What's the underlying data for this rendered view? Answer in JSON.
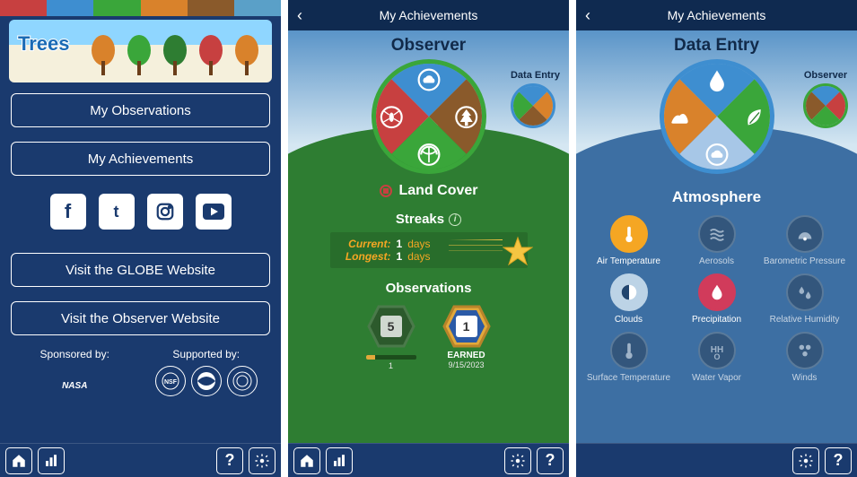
{
  "screen1": {
    "trees_label": "Trees",
    "buttons": {
      "my_observations": "My Observations",
      "my_achievements": "My Achievements",
      "visit_globe": "Visit the GLOBE Website",
      "visit_observer": "Visit the Observer Website"
    },
    "social": [
      "facebook",
      "twitter",
      "instagram",
      "youtube"
    ],
    "sponsored_by": "Sponsored by:",
    "supported_by": "Supported by:",
    "sponsor_logos": [
      "NASA"
    ],
    "supporter_logos": [
      "NSF",
      "NOAA",
      "DOS"
    ]
  },
  "screen2": {
    "header": "My Achievements",
    "title": "Observer",
    "mini_label": "Data Entry",
    "wheel_border": "#3aa63a",
    "wheel_quads": [
      {
        "bg": "#3e8ed0",
        "icon": "cloud"
      },
      {
        "bg": "#8a5a2b",
        "icon": "tree"
      },
      {
        "bg": "#c74040",
        "icon": "mosquito"
      },
      {
        "bg": "#3aa63a",
        "icon": "landcover"
      }
    ],
    "mini_border": "#3e8ed0",
    "mini_quads": [
      "#3e8ed0",
      "#d9822b",
      "#3aa63a",
      "#8a5a2b"
    ],
    "selected_label": "Land Cover",
    "streaks_label": "Streaks",
    "streak_current_label": "Current:",
    "streak_current_val": "1",
    "streak_longest_label": "Longest:",
    "streak_longest_val": "1",
    "streak_unit": "days",
    "observations_label": "Observations",
    "badge_locked": {
      "num": "5",
      "progress": 0.18,
      "count": "1"
    },
    "badge_earned": {
      "num": "1",
      "label": "EARNED",
      "date": "9/15/2023"
    }
  },
  "screen3": {
    "header": "My Achievements",
    "title": "Data Entry",
    "mini_label": "Observer",
    "wheel_border": "#3e8ed0",
    "wheel_quads": [
      {
        "bg": "#3e8ed0",
        "icon": "drop"
      },
      {
        "bg": "#3aa63a",
        "icon": "leaf"
      },
      {
        "bg": "#d9822b",
        "icon": "soil"
      },
      {
        "bg": "#a7c7e7",
        "icon": "cloud"
      }
    ],
    "mini_border": "#3aa63a",
    "mini_quads": [
      "#3e8ed0",
      "#c74040",
      "#8a5a2b",
      "#3aa63a"
    ],
    "section_label": "Atmosphere",
    "items": [
      {
        "label": "Air Temperature",
        "color": "#f5a623",
        "active": true,
        "icon": "thermo"
      },
      {
        "label": "Aerosols",
        "color": "#7a8fa6",
        "active": false,
        "icon": "waves"
      },
      {
        "label": "Barometric Pressure",
        "color": "#5aa0c8",
        "active": false,
        "icon": "gauge"
      },
      {
        "label": "Clouds",
        "color": "#bcd3e6",
        "active": true,
        "icon": "halfcircle"
      },
      {
        "label": "Precipitation",
        "color": "#d13b5b",
        "active": true,
        "icon": "raindrop"
      },
      {
        "label": "Relative Humidity",
        "color": "#6b7fb5",
        "active": false,
        "icon": "drops"
      },
      {
        "label": "Surface Temperature",
        "color": "#4ea64e",
        "active": false,
        "icon": "thermo"
      },
      {
        "label": "Water Vapor",
        "color": "#6b7fb5",
        "active": false,
        "icon": "hho"
      },
      {
        "label": "Winds",
        "color": "#6b7fb5",
        "active": false,
        "icon": "dots"
      }
    ]
  },
  "nav": {
    "home": "home",
    "chart": "chart",
    "help": "?",
    "gear": "gear"
  }
}
